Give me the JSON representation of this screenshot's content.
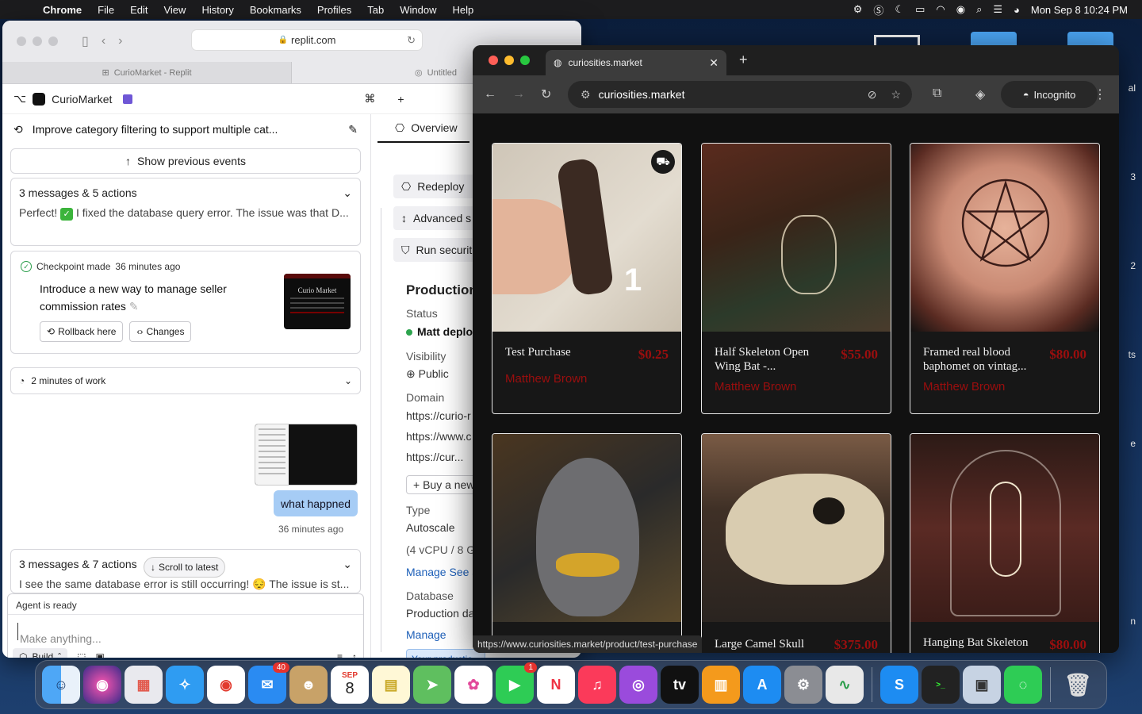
{
  "menubar": {
    "app": "Chrome",
    "items": [
      "File",
      "Edit",
      "View",
      "History",
      "Bookmarks",
      "Profiles",
      "Tab",
      "Window",
      "Help"
    ],
    "datetime": "Mon Sep 8  10:24 PM"
  },
  "desktop": {
    "edge_labels": [
      "al",
      "3",
      "2",
      "ts",
      "e",
      "n"
    ]
  },
  "safari": {
    "url": "replit.com",
    "tabs": [
      "CurioMarket - Replit",
      "Untitled"
    ]
  },
  "replit": {
    "project": "CurioMarket",
    "task_title": "Improve category filtering to support multiple cat...",
    "show_prev": "Show previous events",
    "msg1": {
      "header": "3 messages & 5 actions",
      "preview_a": "Perfect!",
      "preview_b": "I fixed the database query error. The issue was that D..."
    },
    "checkpoint": {
      "label": "Checkpoint made",
      "time": "36 minutes ago",
      "desc": "Introduce a new way to manage seller commission rates",
      "rollback": "Rollback here",
      "changes": "Changes",
      "thumb_title": "Curio Market"
    },
    "work": "2 minutes of work",
    "user_msg": "what happned",
    "user_time": "36 minutes ago",
    "msg2": {
      "header": "3 messages & 7 actions",
      "preview": "I see the same database error is still occurring! 😔 The issue is st..."
    },
    "scroll_latest": "Scroll to latest",
    "input": {
      "status": "Agent is ready",
      "placeholder": "Make anything...",
      "mode": "Build"
    }
  },
  "deploy": {
    "tab": "Overview",
    "actions": [
      "Redeploy",
      "Advanced s",
      "Run securit"
    ],
    "heading": "Production",
    "status_label": "Status",
    "status_value": "Matt deploy",
    "visibility_label": "Visibility",
    "visibility_value": "Public",
    "domain_label": "Domain",
    "domains": [
      "https://curio-r",
      "https://www.c",
      "https://cur..."
    ],
    "buy": "+ Buy a new d",
    "type_label": "Type",
    "type_value": "Autoscale",
    "type_spec": "(4 vCPU / 8 Gi",
    "manage": "Manage",
    "see": "See a",
    "db_label": "Database",
    "db_value": "Production da",
    "manage2": "Manage",
    "notice": "Your productio is ready! Your"
  },
  "chrome": {
    "tab_title": "curiosities.market",
    "url": "curiosities.market",
    "profile": "Incognito",
    "status_url": "https://www.curiosities.market/product/test-purchase",
    "products": [
      {
        "name": "Test Purchase",
        "price": "$0.25",
        "seller": "Matthew Brown"
      },
      {
        "name": "Half Skeleton Open Wing Bat -...",
        "price": "$55.00",
        "seller": "Matthew Brown"
      },
      {
        "name": "Framed real blood baphomet on vintag...",
        "price": "$80.00",
        "seller": "Matthew Brown"
      },
      {
        "name": "",
        "price": "",
        "seller": ""
      },
      {
        "name": "Large Camel Skull",
        "price": "$375.00",
        "seller": ""
      },
      {
        "name": "Hanging Bat Skeleton",
        "price": "$80.00",
        "seller": ""
      }
    ]
  },
  "dock": {
    "mail_badge": "40",
    "facetime_badge": "1",
    "calendar_month": "SEP",
    "calendar_day": "8"
  }
}
